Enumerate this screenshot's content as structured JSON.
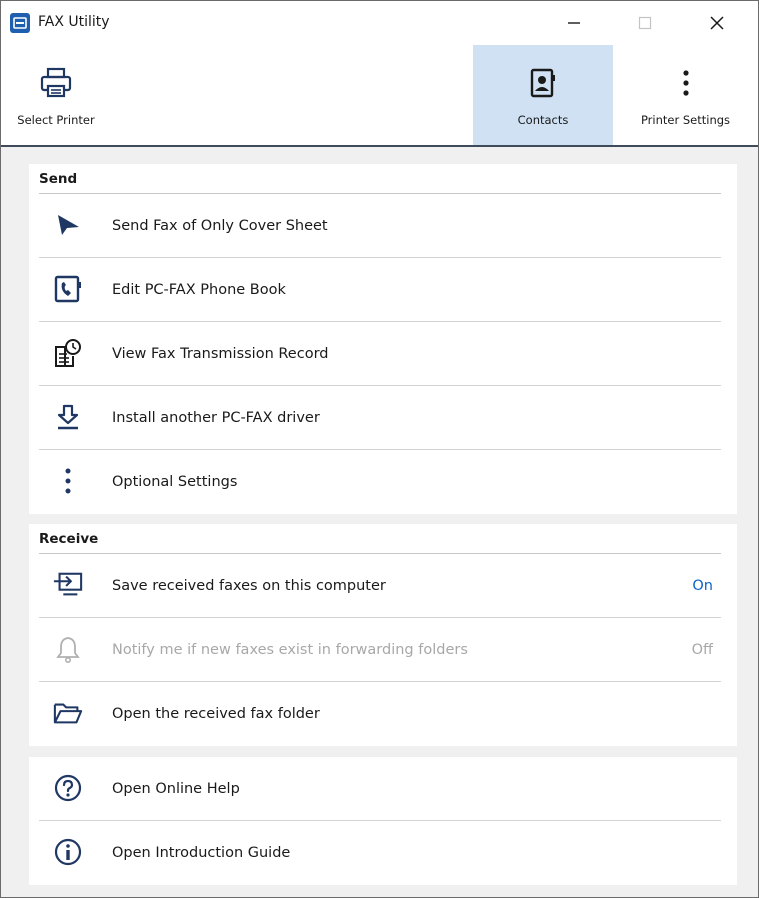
{
  "window": {
    "title": "FAX Utility"
  },
  "toolbar": {
    "select_printer": "Select Printer",
    "contacts": "Contacts",
    "printer_settings": "Printer Settings"
  },
  "send": {
    "heading": "Send",
    "items": [
      {
        "label": "Send Fax of Only Cover Sheet",
        "icon": "send-arrow-icon"
      },
      {
        "label": "Edit PC-FAX Phone Book",
        "icon": "phone-book-icon"
      },
      {
        "label": "View Fax Transmission Record",
        "icon": "transmission-record-icon"
      },
      {
        "label": "Install another PC-FAX driver",
        "icon": "download-icon"
      },
      {
        "label": "Optional Settings",
        "icon": "more-vertical-icon"
      }
    ]
  },
  "receive": {
    "heading": "Receive",
    "items": [
      {
        "label": "Save received faxes on this computer",
        "value": "On",
        "icon": "save-to-computer-icon",
        "enabled": true
      },
      {
        "label": "Notify me if new faxes exist in forwarding folders",
        "value": "Off",
        "icon": "bell-icon",
        "enabled": false
      },
      {
        "label": "Open the received fax folder",
        "icon": "folder-open-icon",
        "enabled": true
      }
    ]
  },
  "help": {
    "items": [
      {
        "label": "Open Online Help",
        "icon": "help-circle-icon"
      },
      {
        "label": "Open Introduction Guide",
        "icon": "info-circle-icon"
      }
    ]
  },
  "colors": {
    "accent_blue": "#0a64c8",
    "selected_tab": "#cfe1f3",
    "icon_navy": "#1f3763",
    "disabled_text": "#a8a8a8"
  }
}
